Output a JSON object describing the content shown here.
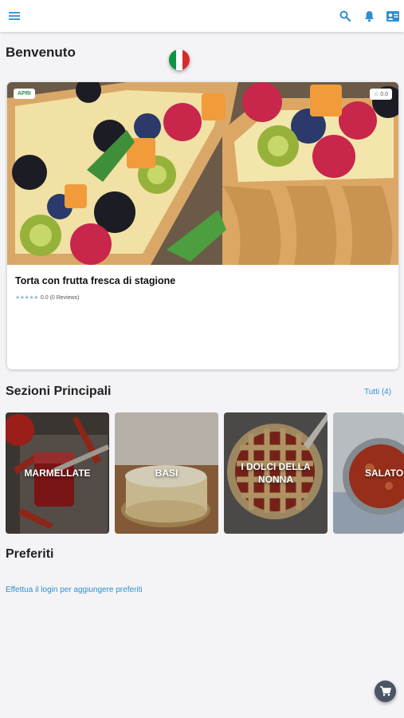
{
  "header": {
    "menu_icon": "menu-icon",
    "search_icon": "search-icon",
    "notifications_icon": "bell-icon",
    "contact_icon": "contact-card-icon",
    "accent_color": "#2f8fcf"
  },
  "welcome": {
    "title": "Benvenuto",
    "language_flag": "italy-flag-icon"
  },
  "featured": {
    "status_badge": "APRI",
    "rating_badge": "☆ 0.0",
    "title": "Torta con frutta fresca di stagione",
    "stars": "★★★★★",
    "rating_text": "0.0 (0 Reviews)"
  },
  "sections": {
    "title": "Sezioni Principali",
    "see_all": "Tutti (4)",
    "items": [
      {
        "label": "MARMELLATE"
      },
      {
        "label": "BASI"
      },
      {
        "label": "I DOLCI DELLA NONNA"
      },
      {
        "label": "SALATO"
      }
    ]
  },
  "favorites": {
    "title": "Preferiti",
    "login_prompt": "Effettua il login per aggiungere preferiti"
  },
  "cart_icon": "cart-icon"
}
